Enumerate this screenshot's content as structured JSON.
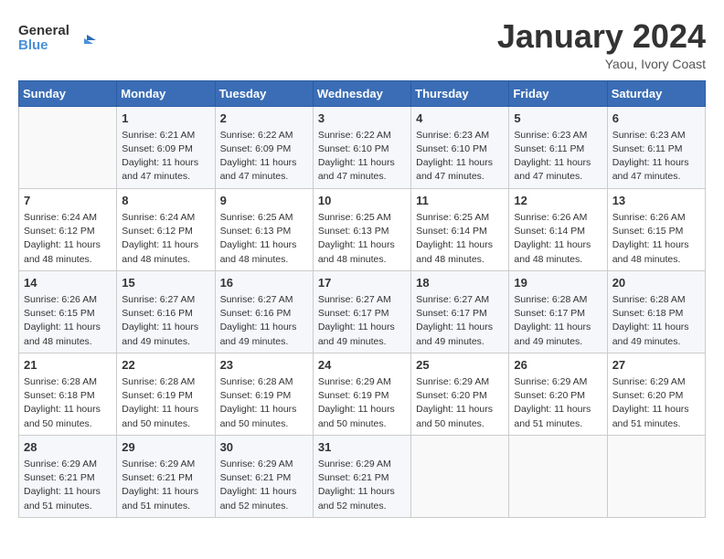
{
  "header": {
    "logo_line1": "General",
    "logo_line2": "Blue",
    "month": "January 2024",
    "location": "Yaou, Ivory Coast"
  },
  "weekdays": [
    "Sunday",
    "Monday",
    "Tuesday",
    "Wednesday",
    "Thursday",
    "Friday",
    "Saturday"
  ],
  "weeks": [
    [
      {
        "day": "",
        "info": ""
      },
      {
        "day": "1",
        "info": "Sunrise: 6:21 AM\nSunset: 6:09 PM\nDaylight: 11 hours and 47 minutes."
      },
      {
        "day": "2",
        "info": "Sunrise: 6:22 AM\nSunset: 6:09 PM\nDaylight: 11 hours and 47 minutes."
      },
      {
        "day": "3",
        "info": "Sunrise: 6:22 AM\nSunset: 6:10 PM\nDaylight: 11 hours and 47 minutes."
      },
      {
        "day": "4",
        "info": "Sunrise: 6:23 AM\nSunset: 6:10 PM\nDaylight: 11 hours and 47 minutes."
      },
      {
        "day": "5",
        "info": "Sunrise: 6:23 AM\nSunset: 6:11 PM\nDaylight: 11 hours and 47 minutes."
      },
      {
        "day": "6",
        "info": "Sunrise: 6:23 AM\nSunset: 6:11 PM\nDaylight: 11 hours and 47 minutes."
      }
    ],
    [
      {
        "day": "7",
        "info": "Sunrise: 6:24 AM\nSunset: 6:12 PM\nDaylight: 11 hours and 48 minutes."
      },
      {
        "day": "8",
        "info": "Sunrise: 6:24 AM\nSunset: 6:12 PM\nDaylight: 11 hours and 48 minutes."
      },
      {
        "day": "9",
        "info": "Sunrise: 6:25 AM\nSunset: 6:13 PM\nDaylight: 11 hours and 48 minutes."
      },
      {
        "day": "10",
        "info": "Sunrise: 6:25 AM\nSunset: 6:13 PM\nDaylight: 11 hours and 48 minutes."
      },
      {
        "day": "11",
        "info": "Sunrise: 6:25 AM\nSunset: 6:14 PM\nDaylight: 11 hours and 48 minutes."
      },
      {
        "day": "12",
        "info": "Sunrise: 6:26 AM\nSunset: 6:14 PM\nDaylight: 11 hours and 48 minutes."
      },
      {
        "day": "13",
        "info": "Sunrise: 6:26 AM\nSunset: 6:15 PM\nDaylight: 11 hours and 48 minutes."
      }
    ],
    [
      {
        "day": "14",
        "info": "Sunrise: 6:26 AM\nSunset: 6:15 PM\nDaylight: 11 hours and 48 minutes."
      },
      {
        "day": "15",
        "info": "Sunrise: 6:27 AM\nSunset: 6:16 PM\nDaylight: 11 hours and 49 minutes."
      },
      {
        "day": "16",
        "info": "Sunrise: 6:27 AM\nSunset: 6:16 PM\nDaylight: 11 hours and 49 minutes."
      },
      {
        "day": "17",
        "info": "Sunrise: 6:27 AM\nSunset: 6:17 PM\nDaylight: 11 hours and 49 minutes."
      },
      {
        "day": "18",
        "info": "Sunrise: 6:27 AM\nSunset: 6:17 PM\nDaylight: 11 hours and 49 minutes."
      },
      {
        "day": "19",
        "info": "Sunrise: 6:28 AM\nSunset: 6:17 PM\nDaylight: 11 hours and 49 minutes."
      },
      {
        "day": "20",
        "info": "Sunrise: 6:28 AM\nSunset: 6:18 PM\nDaylight: 11 hours and 49 minutes."
      }
    ],
    [
      {
        "day": "21",
        "info": "Sunrise: 6:28 AM\nSunset: 6:18 PM\nDaylight: 11 hours and 50 minutes."
      },
      {
        "day": "22",
        "info": "Sunrise: 6:28 AM\nSunset: 6:19 PM\nDaylight: 11 hours and 50 minutes."
      },
      {
        "day": "23",
        "info": "Sunrise: 6:28 AM\nSunset: 6:19 PM\nDaylight: 11 hours and 50 minutes."
      },
      {
        "day": "24",
        "info": "Sunrise: 6:29 AM\nSunset: 6:19 PM\nDaylight: 11 hours and 50 minutes."
      },
      {
        "day": "25",
        "info": "Sunrise: 6:29 AM\nSunset: 6:20 PM\nDaylight: 11 hours and 50 minutes."
      },
      {
        "day": "26",
        "info": "Sunrise: 6:29 AM\nSunset: 6:20 PM\nDaylight: 11 hours and 51 minutes."
      },
      {
        "day": "27",
        "info": "Sunrise: 6:29 AM\nSunset: 6:20 PM\nDaylight: 11 hours and 51 minutes."
      }
    ],
    [
      {
        "day": "28",
        "info": "Sunrise: 6:29 AM\nSunset: 6:21 PM\nDaylight: 11 hours and 51 minutes."
      },
      {
        "day": "29",
        "info": "Sunrise: 6:29 AM\nSunset: 6:21 PM\nDaylight: 11 hours and 51 minutes."
      },
      {
        "day": "30",
        "info": "Sunrise: 6:29 AM\nSunset: 6:21 PM\nDaylight: 11 hours and 52 minutes."
      },
      {
        "day": "31",
        "info": "Sunrise: 6:29 AM\nSunset: 6:21 PM\nDaylight: 11 hours and 52 minutes."
      },
      {
        "day": "",
        "info": ""
      },
      {
        "day": "",
        "info": ""
      },
      {
        "day": "",
        "info": ""
      }
    ]
  ]
}
